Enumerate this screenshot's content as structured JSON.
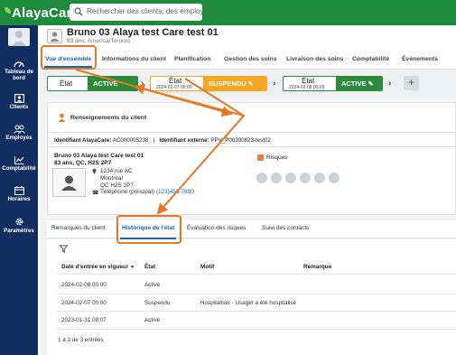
{
  "header": {
    "logo_text": "AlayaCare",
    "search_placeholder": "Rechercher des clients, des employés, ..."
  },
  "sidebar": {
    "items": [
      {
        "label_line1": "Tableau de",
        "label_line2": "bord",
        "icon": "dashboard-icon"
      },
      {
        "label_line1": "Clients",
        "label_line2": "",
        "icon": "clients-icon"
      },
      {
        "label_line1": "Employés",
        "label_line2": "",
        "icon": "employees-icon"
      },
      {
        "label_line1": "Comptabilité",
        "label_line2": "",
        "icon": "accounting-icon"
      },
      {
        "label_line1": "Horaires",
        "label_line2": "",
        "icon": "calendar-icon"
      },
      {
        "label_line1": "Paramètres",
        "label_line2": "",
        "icon": "settings-icon"
      }
    ]
  },
  "patient": {
    "name": "Bruno 03 Alaya test Care test 01",
    "subtitle": "83 ans, America/Toronto"
  },
  "tabs": [
    {
      "label": "Vue d'ensemble",
      "active": true
    },
    {
      "label": "Informations du client"
    },
    {
      "label": "Planification"
    },
    {
      "label": "Gestion des soins"
    },
    {
      "label": "Livraison des soins"
    },
    {
      "label": "Comptabilité"
    },
    {
      "label": "Événements"
    }
  ],
  "status": {
    "state_label": "État",
    "current": "ACTIVE",
    "box2_date": "2024-02-07 00:00",
    "box2_value": "SUSPENDU",
    "box3_date": "2024-02-08 00:00",
    "box3_value": "ACTIVE",
    "plus": "+",
    "colors": {
      "active": "#2c8c3c",
      "suspended": "#f5a623"
    }
  },
  "client_info": {
    "title": "Renseignements du client",
    "alayacare_id_label": "Identifiant AlayaCare:",
    "alayacare_id": "AC000005238",
    "separator": "|",
    "external_id_label": "Identifiant externe:",
    "external_id": "PPV_P00300823-test02",
    "name": "Bruno 03 Alaya test Care test 01",
    "age_loc": "83 ans, QC, H2S 2P7",
    "address_line1": "1234 rue AC",
    "address_line2": "Montréal",
    "address_line3": "QC H2S 2P7",
    "phone_label": "Téléphone (principal)",
    "phone": "(123)456-7890",
    "risks_label": "Risques"
  },
  "subtabs": [
    {
      "label": "Remarques du client"
    },
    {
      "label": "Historique de l'état",
      "active": true
    },
    {
      "label": "Évaluation des risques"
    },
    {
      "label": "Suivi des contacts"
    }
  ],
  "history_table": {
    "columns": [
      "Date d'entrée en vigueur",
      "État",
      "Motif",
      "Remarque"
    ],
    "sort_indicator": "▼",
    "rows": [
      {
        "date": "2024-02-08 00:00",
        "state": "Activé",
        "reason": "",
        "remark": ""
      },
      {
        "date": "2024-02-07 00:00",
        "state": "Suspendu",
        "reason": "Hospitaliser - Usager a été hospitalisé",
        "remark": ""
      },
      {
        "date": "2023-01-31 08:07",
        "state": "Activé",
        "reason": "",
        "remark": ""
      }
    ],
    "footer": "1 à 3 de 3 entrées"
  }
}
